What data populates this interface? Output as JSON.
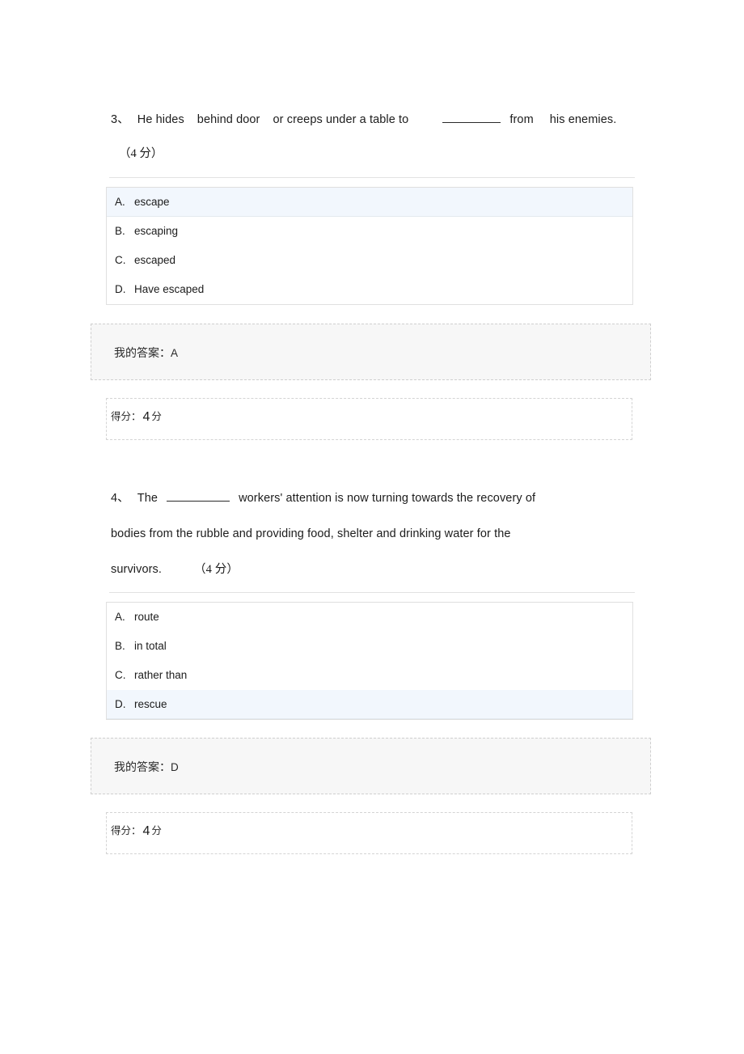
{
  "page": {
    "background": "#ffffff",
    "highlight_color": "#f2f7fd",
    "answer_box_bg": "#f7f7f7",
    "divider_color": "#e2e2e2"
  },
  "questions": [
    {
      "index_label": "3、",
      "stem_part1": "He hides",
      "stem_part2": "behind door",
      "stem_part3": "or creeps under a table to",
      "stem_part4": "from",
      "stem_part5": "his enemies.",
      "points_label": "（4 分）",
      "points_value": "4",
      "options": [
        {
          "letter": "A.",
          "text": "escape",
          "selected": true
        },
        {
          "letter": "B.",
          "text": "escaping",
          "selected": false
        },
        {
          "letter": "C.",
          "text": "escaped",
          "selected": false
        },
        {
          "letter": "D.",
          "text": "Have escaped",
          "selected": false
        }
      ],
      "my_answer_label": "我的答案：",
      "my_answer_value": "A",
      "score_label": "得分：",
      "score_value": "4",
      "score_unit": "分"
    },
    {
      "index_label": "4、",
      "stem_part1": "The",
      "stem_part2": "workers' attention is now turning towards the recovery of",
      "stem_line2": "bodies from the rubble and providing food, shelter and drinking water for the",
      "stem_line3": "survivors.",
      "points_label": "（4 分）",
      "points_value": "4",
      "options": [
        {
          "letter": "A.",
          "text": "route",
          "selected": false
        },
        {
          "letter": "B.",
          "text": "in total",
          "selected": false
        },
        {
          "letter": "C.",
          "text": "rather than",
          "selected": false
        },
        {
          "letter": "D.",
          "text": "rescue",
          "selected": true
        }
      ],
      "my_answer_label": "我的答案：",
      "my_answer_value": "D",
      "score_label": "得分：",
      "score_value": "4",
      "score_unit": "分"
    }
  ]
}
